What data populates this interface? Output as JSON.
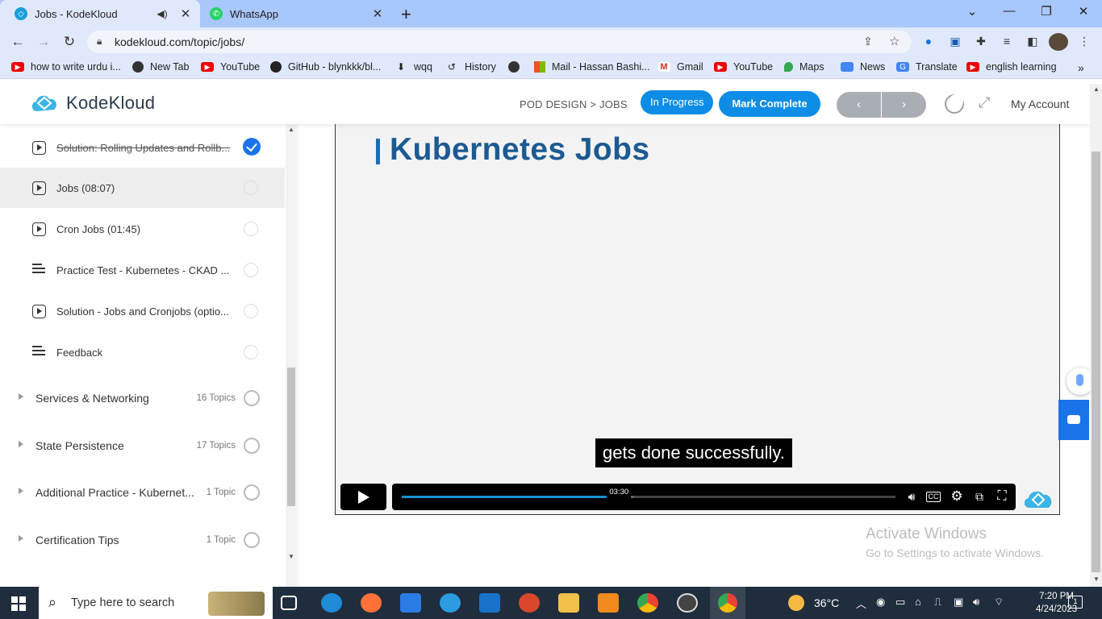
{
  "browser": {
    "tabs": [
      {
        "title": "Jobs - KodeKloud",
        "active": true,
        "audio": true
      },
      {
        "title": "WhatsApp",
        "active": false
      }
    ],
    "url": "kodekloud.com/topic/jobs/",
    "bookmarks": [
      {
        "label": "how to write urdu i...",
        "icon": "youtube-icon"
      },
      {
        "label": "New Tab",
        "icon": "globe-icon"
      },
      {
        "label": "YouTube",
        "icon": "youtube-icon"
      },
      {
        "label": "GitHub - blynkkk/bl...",
        "icon": "github-icon"
      },
      {
        "label": "wqq",
        "icon": "download-icon"
      },
      {
        "label": "History",
        "icon": "history-icon"
      },
      {
        "label": "",
        "icon": "globe-icon"
      },
      {
        "label": "Mail - Hassan Bashi...",
        "icon": "microsoft-icon"
      },
      {
        "label": "Gmail",
        "icon": "gmail-icon"
      },
      {
        "label": "YouTube",
        "icon": "youtube-icon"
      },
      {
        "label": "Maps",
        "icon": "maps-icon"
      },
      {
        "label": "News",
        "icon": "news-icon"
      },
      {
        "label": "Translate",
        "icon": "translate-icon"
      },
      {
        "label": "english learning",
        "icon": "youtube-icon"
      }
    ]
  },
  "header": {
    "brand": "KodeKloud",
    "breadcrumb": "POD DESIGN > JOBS",
    "status": "In Progress",
    "mark_complete": "Mark Complete",
    "prev": "‹",
    "next": "›",
    "account": "My Account"
  },
  "sidebar": {
    "lessons": [
      {
        "label": "Solution: Rolling Updates and Rollb...",
        "type": "video",
        "done": true
      },
      {
        "label": "Jobs (08:07)",
        "type": "video",
        "done": false,
        "current": true
      },
      {
        "label": "Cron Jobs (01:45)",
        "type": "video",
        "done": false
      },
      {
        "label": "Practice Test - Kubernetes - CKAD ...",
        "type": "text",
        "done": false
      },
      {
        "label": "Solution - Jobs and Cronjobs (optio...",
        "type": "video",
        "done": false
      },
      {
        "label": "Feedback",
        "type": "text",
        "done": false
      }
    ],
    "sections": [
      {
        "label": "Services & Networking",
        "count": "16 Topics"
      },
      {
        "label": "State Persistence",
        "count": "17 Topics"
      },
      {
        "label": "Additional Practice - Kubernet...",
        "count": "1 Topic"
      },
      {
        "label": "Certification Tips",
        "count": "1 Topic"
      }
    ]
  },
  "video": {
    "slide_title": "Kubernetes Jobs",
    "caption": "gets done successfully.",
    "current_time": "03:30",
    "progress": 0.44,
    "buffered": 0.47
  },
  "watermark": {
    "title": "Activate Windows",
    "subtitle": "Go to Settings to activate Windows."
  },
  "taskbar": {
    "search_placeholder": "Type here to search",
    "temperature": "36°C",
    "time": "7:20 PM",
    "date": "4/24/2023",
    "notifications": "1"
  },
  "colors": {
    "accent": "#0d8de6",
    "tabstrip": "#a8c7fa",
    "taskbar": "#1f2d3d"
  }
}
